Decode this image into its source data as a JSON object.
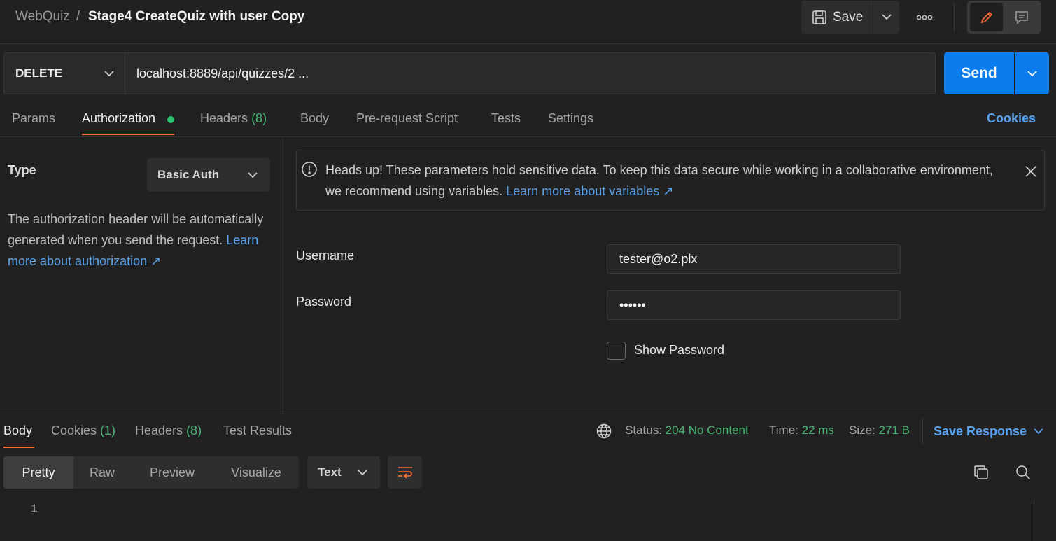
{
  "header": {
    "breadcrumb_root": "WebQuiz",
    "breadcrumb_sep": "/",
    "title": "Stage4 CreateQuiz with user Copy",
    "save_label": "Save",
    "icons": {
      "save": "save-disk-icon",
      "more": "more-horizontal-icon",
      "edit": "pencil-icon",
      "comment": "comment-icon"
    }
  },
  "request": {
    "method": "DELETE",
    "url": "localhost:8889/api/quizzes/2 ...",
    "send_label": "Send"
  },
  "request_tabs": {
    "params": "Params",
    "authorization": "Authorization",
    "headers": "Headers",
    "headers_count": "(8)",
    "body": "Body",
    "prerequest": "Pre-request Script",
    "tests": "Tests",
    "settings": "Settings",
    "cookies": "Cookies"
  },
  "auth": {
    "type_label": "Type",
    "type_value": "Basic Auth",
    "description": "The authorization header will be automatically generated when you send the request.",
    "learn_more": "Learn more about authorization ↗",
    "alert_text": "Heads up! These parameters hold sensitive data. To keep this data secure while working in a collaborative environment, we recommend using variables.",
    "alert_link": "Learn more about variables ↗",
    "username_label": "Username",
    "username_value": "tester@o2.plx",
    "password_label": "Password",
    "password_value": "••••••",
    "show_password_label": "Show Password",
    "show_password_checked": false
  },
  "response": {
    "tabs": {
      "body": "Body",
      "cookies": "Cookies",
      "cookies_count": "(1)",
      "headers": "Headers",
      "headers_count": "(8)",
      "test_results": "Test Results"
    },
    "status_label": "Status:",
    "status_value": "204 No Content",
    "time_label": "Time:",
    "time_value": "22 ms",
    "size_label": "Size:",
    "size_value": "271 B",
    "save_response": "Save Response",
    "views": [
      "Pretty",
      "Raw",
      "Preview",
      "Visualize"
    ],
    "format": "Text",
    "line_numbers": [
      "1"
    ]
  },
  "colors": {
    "accent_orange": "#ff6c37",
    "send_blue": "#097bed",
    "link_blue": "#58a3f0",
    "success_green": "#49b876"
  }
}
